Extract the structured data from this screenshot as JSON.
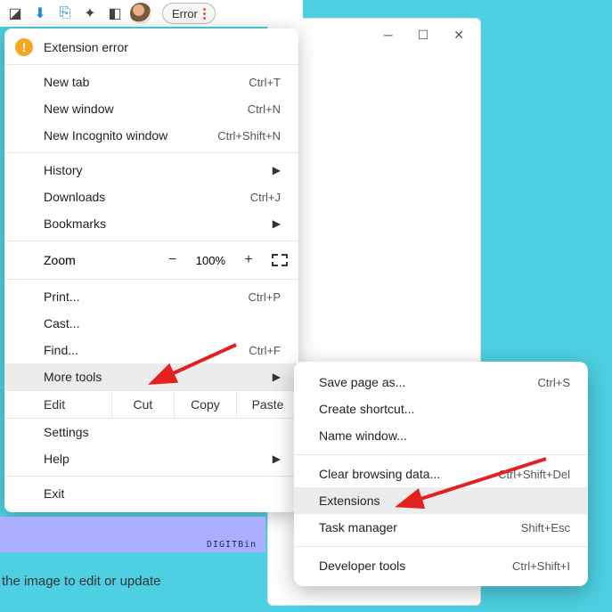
{
  "toolbar": {
    "error_label": "Error"
  },
  "menu": {
    "extension_error": "Extension error",
    "new_tab": {
      "label": "New tab",
      "shortcut": "Ctrl+T"
    },
    "new_window": {
      "label": "New window",
      "shortcut": "Ctrl+N"
    },
    "new_incognito": {
      "label": "New Incognito window",
      "shortcut": "Ctrl+Shift+N"
    },
    "history": "History",
    "downloads": {
      "label": "Downloads",
      "shortcut": "Ctrl+J"
    },
    "bookmarks": "Bookmarks",
    "zoom": {
      "label": "Zoom",
      "value": "100%"
    },
    "print": {
      "label": "Print...",
      "shortcut": "Ctrl+P"
    },
    "cast": "Cast...",
    "find": {
      "label": "Find...",
      "shortcut": "Ctrl+F"
    },
    "more_tools": "More tools",
    "edit": {
      "label": "Edit",
      "cut": "Cut",
      "copy": "Copy",
      "paste": "Paste"
    },
    "settings": "Settings",
    "help": "Help",
    "exit": "Exit"
  },
  "submenu": {
    "save_page": {
      "label": "Save page as...",
      "shortcut": "Ctrl+S"
    },
    "create_shortcut": "Create shortcut...",
    "name_window": "Name window...",
    "clear_data": {
      "label": "Clear browsing data...",
      "shortcut": "Ctrl+Shift+Del"
    },
    "extensions": "Extensions",
    "task_manager": {
      "label": "Task manager",
      "shortcut": "Shift+Esc"
    },
    "developer_tools": {
      "label": "Developer tools",
      "shortcut": "Ctrl+Shift+I"
    }
  },
  "footer": {
    "watermark": "DIGITBin",
    "caption": "the image to edit or update"
  }
}
